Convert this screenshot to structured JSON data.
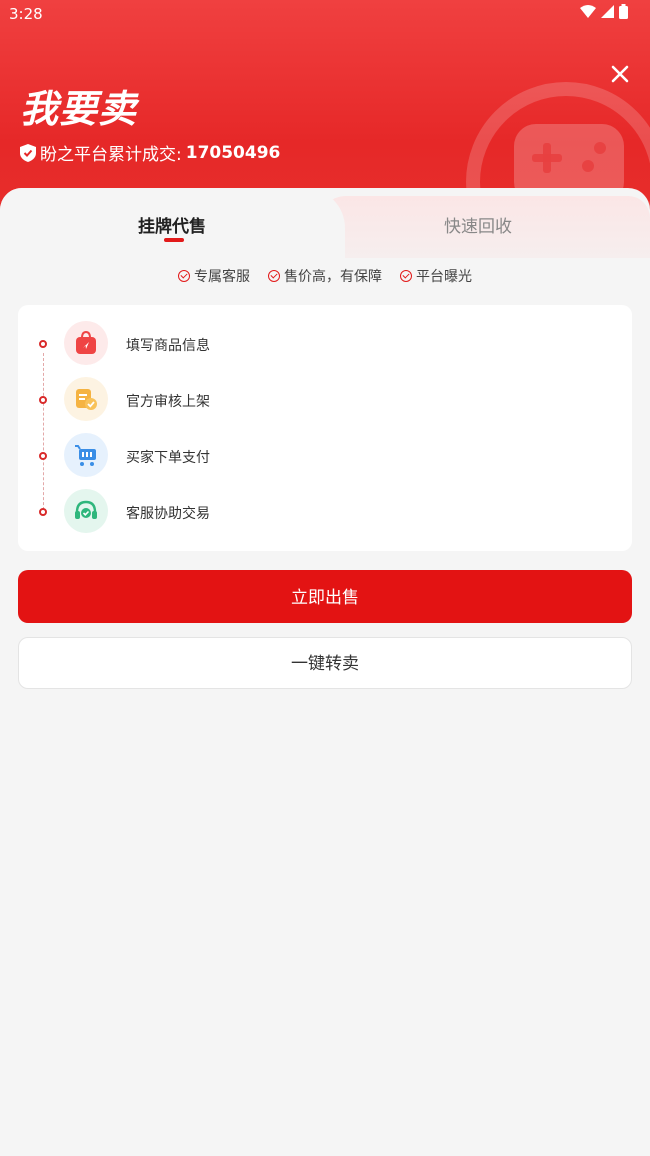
{
  "status_bar": {
    "time": "3:28"
  },
  "header": {
    "title": "我要卖",
    "stats_label": "盼之平台累计成交:",
    "stats_value": "17050496"
  },
  "tabs": [
    {
      "label": "挂牌代售",
      "active": true
    },
    {
      "label": "快速回收",
      "active": false
    }
  ],
  "features": [
    "专属客服",
    "售价高，有保障",
    "平台曝光"
  ],
  "steps": [
    {
      "label": "填写商品信息",
      "icon": "shopping-bag-icon"
    },
    {
      "label": "官方审核上架",
      "icon": "review-document-icon"
    },
    {
      "label": "买家下单支付",
      "icon": "shopping-cart-icon"
    },
    {
      "label": "客服协助交易",
      "icon": "headset-icon"
    }
  ],
  "buttons": {
    "primary": "立即出售",
    "secondary": "一键转卖"
  },
  "colors": {
    "brand_red": "#e31313"
  }
}
